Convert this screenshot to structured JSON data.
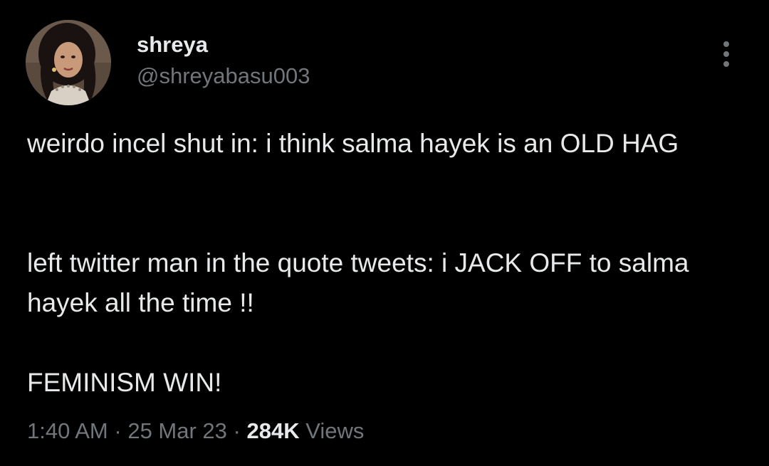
{
  "author": {
    "display_name": "shreya",
    "handle": "@shreyabasu003",
    "avatar": "profile-photo"
  },
  "menu": {
    "icon": "more-vertical-icon"
  },
  "tweet": {
    "paragraphs": [
      "weirdo incel shut in: i think salma hayek is an OLD HAG",
      "left twitter man in the quote tweets: i JACK OFF to salma hayek all the time !!",
      "FEMINISM WIN!"
    ],
    "time": "1:40 AM",
    "date": "25 Mar 23",
    "separator": "·",
    "views_count": "284K",
    "views_label": "Views"
  },
  "colors": {
    "background": "#000000",
    "primary_text": "#e7e9ea",
    "secondary_text": "#71767b"
  }
}
